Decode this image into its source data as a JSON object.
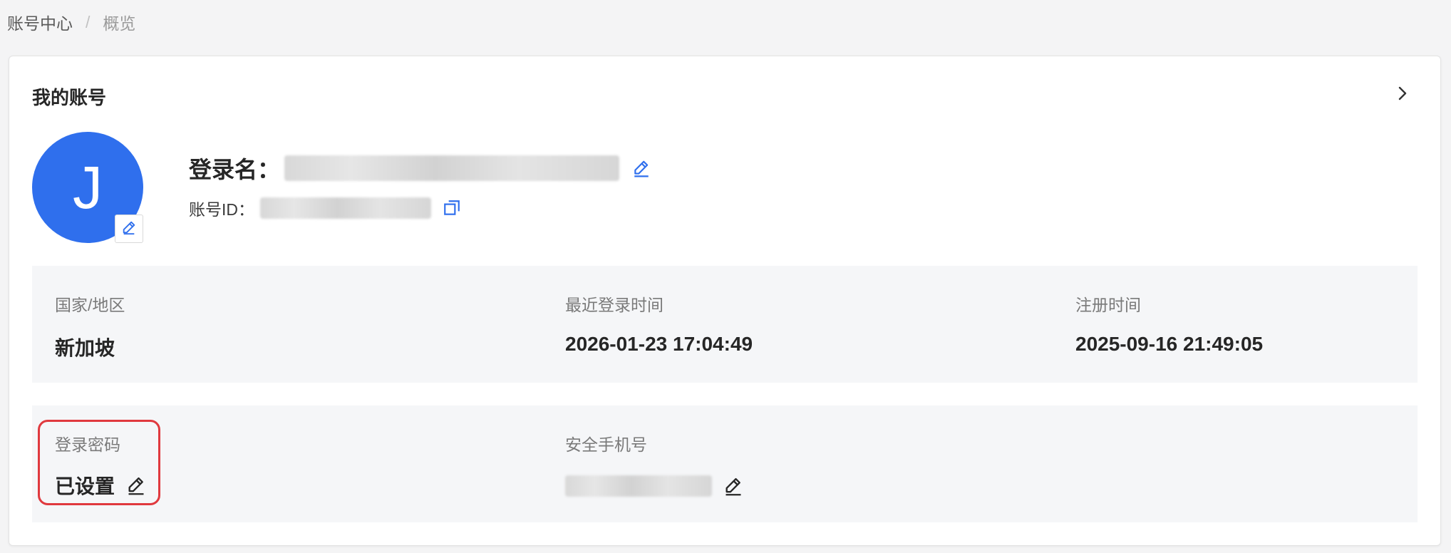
{
  "breadcrumb": {
    "items": [
      "账号中心",
      "概览"
    ],
    "separator": "/"
  },
  "card": {
    "title": "我的账号",
    "avatar_letter": "J",
    "login_name_label": "登录名：",
    "account_id_label": "账号ID："
  },
  "info": {
    "region_label": "国家/地区",
    "region_value": "新加坡",
    "last_login_label": "最近登录时间",
    "last_login_value": "2026-01-23 17:04:49",
    "register_label": "注册时间",
    "register_value": "2025-09-16 21:49:05"
  },
  "security": {
    "password_label": "登录密码",
    "password_value": "已设置",
    "phone_label": "安全手机号"
  },
  "colors": {
    "accent": "#2f6fed",
    "highlight": "#e0393e",
    "panel_bg": "#f5f6f8"
  }
}
